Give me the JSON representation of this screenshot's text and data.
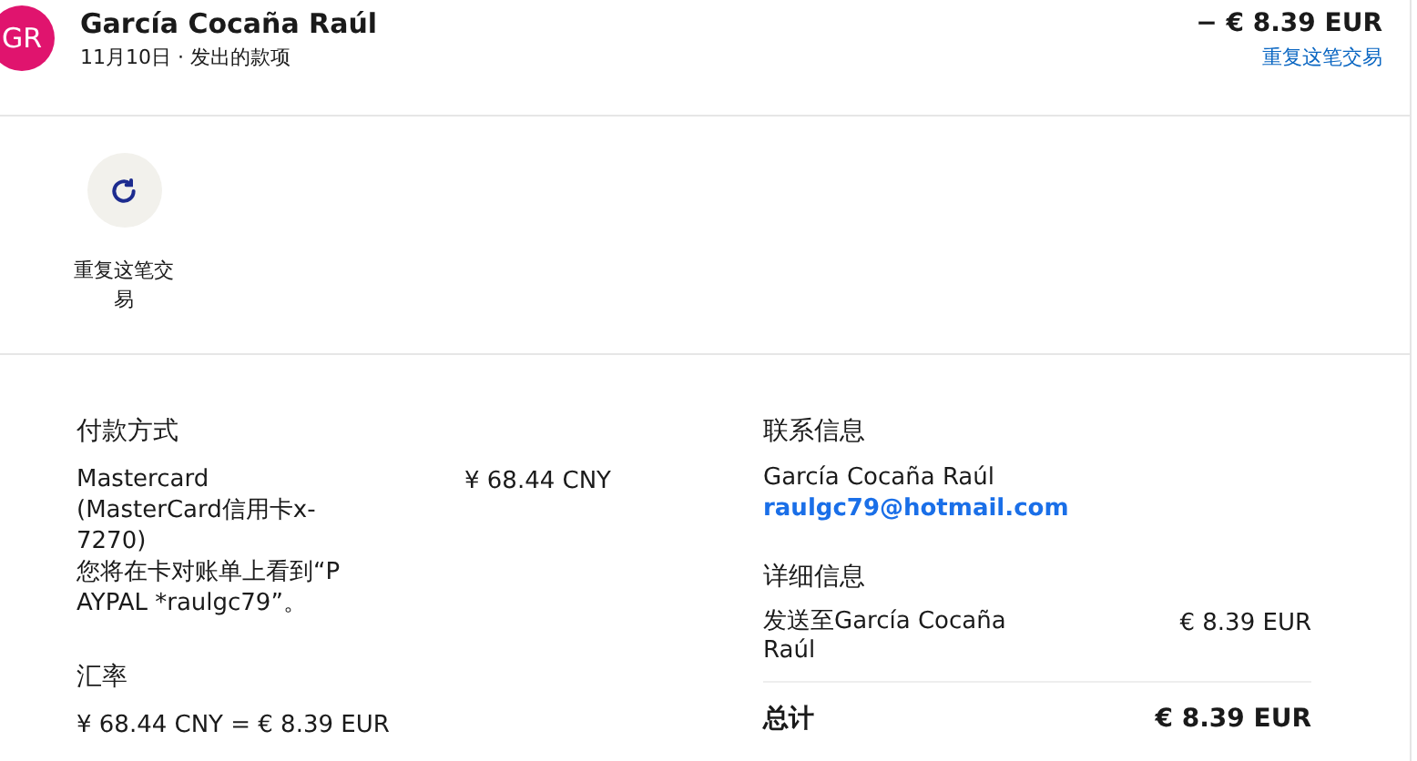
{
  "header": {
    "avatar": "GR",
    "name": "García Cocaña Raúl",
    "subtitle": "11月10日 · 发出的款项",
    "amount": "− € 8.39 EUR",
    "link": "重复这笔交易"
  },
  "actions": [
    {
      "label": "重复这笔交易"
    }
  ],
  "payment": {
    "title": "付款方式",
    "method": "Mastercard (MasterCard信用卡x-7270)",
    "note": "您将在卡对账单上看到“PAYPAL *raulgc79”。",
    "amount": "¥ 68.44 CNY"
  },
  "exchange": {
    "title": "汇率",
    "value": "¥ 68.44 CNY = € 8.39 EUR"
  },
  "contact": {
    "title": "联系信息",
    "name": "García Cocaña Raúl",
    "email": "raulgc79@hotmail.com"
  },
  "details": {
    "title": "详细信息",
    "rows": [
      {
        "label": "发送至García Cocaña Raúl",
        "amount": "€ 8.39 EUR"
      }
    ],
    "total": {
      "label": "总计",
      "amount": "€ 8.39 EUR"
    }
  }
}
